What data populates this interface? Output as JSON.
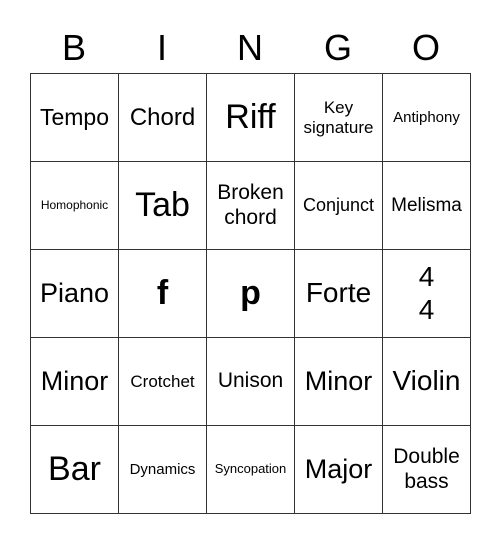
{
  "header": [
    "B",
    "I",
    "N",
    "G",
    "O"
  ],
  "cells": [
    [
      "Tempo",
      "Chord",
      "Riff",
      "Key signature",
      "Antiphony"
    ],
    [
      "Homophonic",
      "Tab",
      "Broken chord",
      "Conjunct",
      "Melisma"
    ],
    [
      "Piano",
      "f",
      "p",
      "Forte",
      "4\n4"
    ],
    [
      "Minor",
      "Crotchet",
      "Unison",
      "Minor",
      "Violin"
    ],
    [
      "Bar",
      "Dynamics",
      "Syncopation",
      "Major",
      "Double bass"
    ]
  ]
}
